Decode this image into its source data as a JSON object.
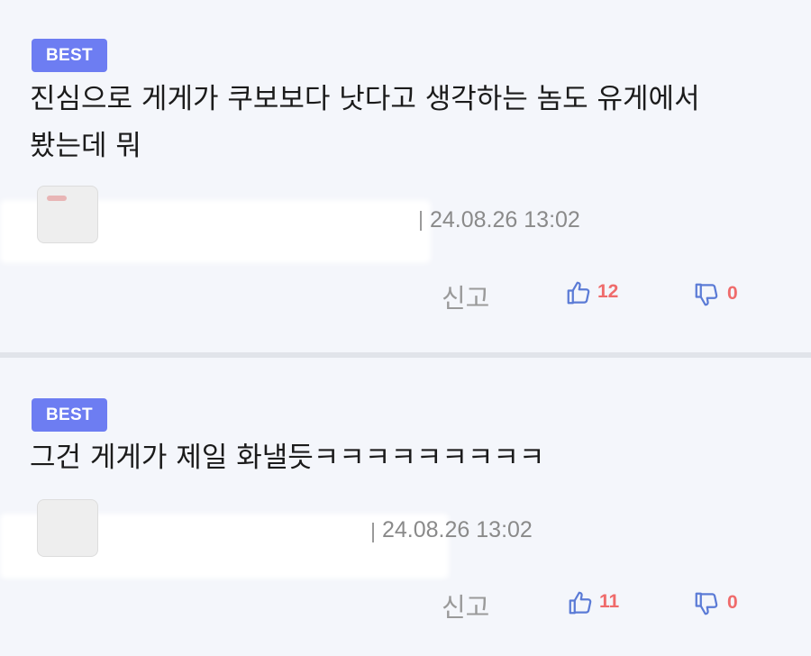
{
  "comments": [
    {
      "badge": "BEST",
      "text_line1": "진심으로 게게가 쿠보보다 낫다고 생각하는 놈도 유게에서",
      "text_line2": "봤는데 뭐",
      "date": "24.08.26 13:02",
      "report_label": "신고",
      "likes": "12",
      "dislikes": "0"
    },
    {
      "badge": "BEST",
      "text_line1": "그건 게게가 제일 화낼듯ㅋㅋㅋㅋㅋㅋㅋㅋㅋ",
      "date": "24.08.26 13:02",
      "report_label": "신고",
      "likes": "11",
      "dislikes": "0"
    }
  ],
  "colors": {
    "badge": "#6d7df2",
    "thumb": "#5b7bd6",
    "count": "#ef6b6b",
    "background": "#f4f6fb"
  },
  "icons": {
    "like": "thumbs-up-icon",
    "dislike": "thumbs-down-icon"
  }
}
